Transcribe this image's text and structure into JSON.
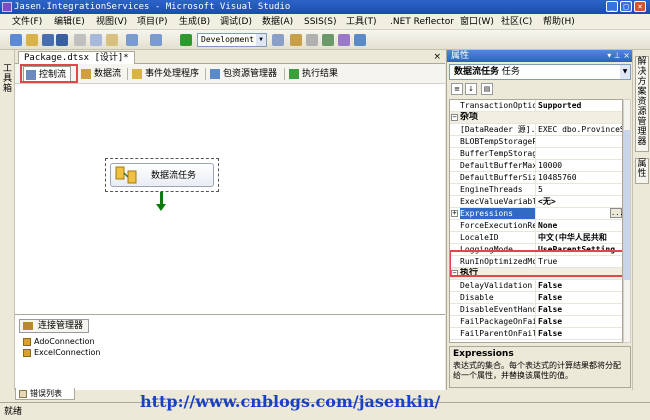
{
  "window": {
    "title": "Jasen.IntegrationServices - Microsoft Visual Studio",
    "buttons": [
      "_",
      "□",
      "×"
    ]
  },
  "menu": [
    "文件(F)",
    "编辑(E)",
    "视图(V)",
    "项目(P)",
    "生成(B)",
    "调试(D)",
    "数据(A)",
    "SSIS(S)",
    "工具(T)",
    ".NET Reflector",
    "窗口(W)",
    "社区(C)",
    "帮助(H)"
  ],
  "toolbar": {
    "configuration": "Development"
  },
  "left_strip": {
    "toolbox_label": "工具箱"
  },
  "document": {
    "tab_label": "Package.dtsx [设计]*",
    "close_glyph": "×"
  },
  "designer_tabs": [
    "控制流",
    "数据流",
    "事件处理程序",
    "包资源管理器",
    "执行结果"
  ],
  "canvas": {
    "task_label": "数据流任务"
  },
  "connections": {
    "header": "连接管理器",
    "items": [
      "AdoConnection",
      "ExcelConnection"
    ],
    "error_tab": "错误列表"
  },
  "properties": {
    "title": "属性",
    "object_name": "数据流任务",
    "object_type": "任务",
    "rows": [
      {
        "name": "TransactionOption",
        "value": "Supported",
        "bold": true,
        "kind": "prop"
      },
      {
        "name": "杂项",
        "value": "",
        "kind": "cat",
        "expander": "−"
      },
      {
        "name": "[DataReader 源].[SqlC",
        "value": "EXEC dbo.ProvinceSe",
        "kind": "prop"
      },
      {
        "name": "BLOBTempStoragePa",
        "value": "",
        "kind": "prop"
      },
      {
        "name": "BufferTempStorage",
        "value": "",
        "kind": "prop"
      },
      {
        "name": "DefaultBufferMaxR",
        "value": "10000",
        "kind": "prop"
      },
      {
        "name": "DefaultBufferSize",
        "value": "10485760",
        "kind": "prop"
      },
      {
        "name": "EngineThreads",
        "value": "5",
        "kind": "prop"
      },
      {
        "name": "ExecValueVariable",
        "value": "<无>",
        "bold": true,
        "kind": "prop"
      },
      {
        "name": "Expressions",
        "value": "",
        "kind": "prop",
        "expander": "+",
        "selected": true,
        "ellipsis": "..."
      },
      {
        "name": "ForceExecutionRes",
        "value": "None",
        "bold": true,
        "kind": "prop"
      },
      {
        "name": "LocaleID",
        "value": "中文(中华人民共和",
        "bold": true,
        "kind": "prop"
      },
      {
        "name": "LoggingMode",
        "value": "UseParentSetting",
        "bold": true,
        "kind": "prop"
      },
      {
        "name": "RunInOptimizedMod",
        "value": "True",
        "kind": "prop"
      },
      {
        "name": "执行",
        "value": "",
        "kind": "cat",
        "expander": "−"
      },
      {
        "name": "DelayValidation",
        "value": "False",
        "bold": true,
        "kind": "prop"
      },
      {
        "name": "Disable",
        "value": "False",
        "bold": true,
        "kind": "prop"
      },
      {
        "name": "DisableEventHandl",
        "value": "False",
        "bold": true,
        "kind": "prop"
      },
      {
        "name": "FailPackageOnFail",
        "value": "False",
        "bold": true,
        "kind": "prop"
      },
      {
        "name": "FailParentOnFailu",
        "value": "False",
        "bold": true,
        "kind": "prop"
      }
    ],
    "description_title": "Expressions",
    "description_text": "表达式的集合。每个表达式的计算结果都将分配给一个属性，并替换该属性的值。"
  },
  "right_strip": {
    "tabs": [
      "解决方案资源管理器",
      "属性"
    ]
  },
  "status": {
    "text": "就绪"
  },
  "watermark": {
    "url": "http://www.cnblogs.com/jasenkin/"
  },
  "colors": {
    "titlebar": "#2d64c8",
    "annotation_red": "#e0474c",
    "selection": "#316ac5",
    "connector_green": "#0c7a0c"
  }
}
